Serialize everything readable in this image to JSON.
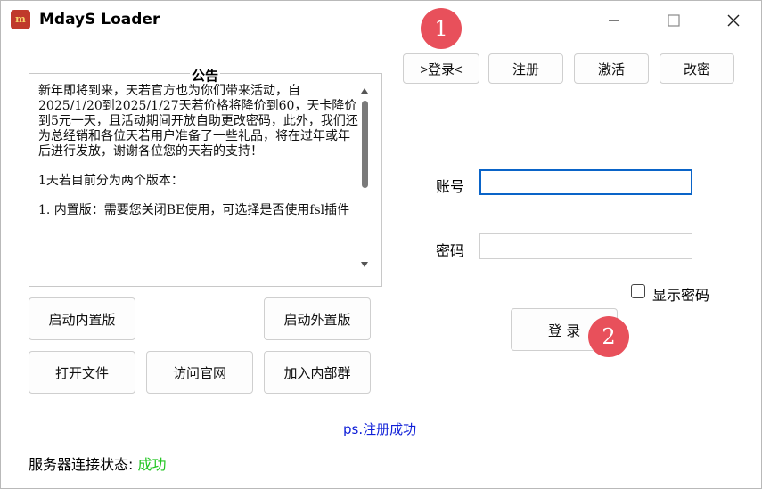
{
  "window": {
    "title": "MdayS Loader",
    "icon_name": "app-logo-icon",
    "controls": {
      "minimize": "minimize-icon",
      "maximize": "maximize-icon",
      "close": "close-icon"
    }
  },
  "top_buttons": {
    "login_tab": ">登录<",
    "register": "注册",
    "activate": "激活",
    "change_password": "改密"
  },
  "notice": {
    "title": "公告",
    "paragraphs": [
      "新年即将到来，天若官方也为你们带来活动，自2025/1/20到2025/1/27天若价格将降价到60，天卡降价到5元一天，且活动期间开放自助更改密码，此外，我们还为总经销和各位天若用户准备了一些礼品，将在过年或年后进行发放，谢谢各位您的天若的支持！",
      "1天若目前分为两个版本：",
      "1. 内置版：需要您关闭BE使用，可选择是否使用fsl插件"
    ]
  },
  "left_buttons": {
    "start_internal": "启动内置版",
    "start_external": "启动外置版",
    "open_file": "打开文件",
    "visit_site": "访问官网",
    "join_group": "加入内部群"
  },
  "form": {
    "account_label": "账号",
    "account_value": "",
    "password_label": "密码",
    "password_value": "",
    "show_password_label": "显示密码",
    "show_password_checked": false,
    "login_button": "登 录"
  },
  "ps_message": "ps.注册成功",
  "status": {
    "label": "服务器连接状态:",
    "value": "成功",
    "value_color": "#22c622"
  },
  "annotations": {
    "badge1": "1",
    "badge2": "2",
    "badge_color": "#e8505b"
  }
}
